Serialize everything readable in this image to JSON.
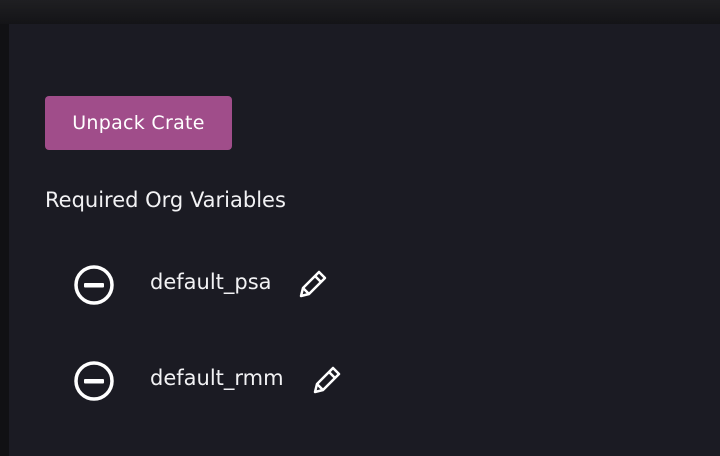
{
  "actions": {
    "unpack_label": "Unpack Crate"
  },
  "org_variables": {
    "title": "Required Org Variables",
    "items": [
      {
        "name": "default_psa",
        "remove_icon": "minus-circle-icon",
        "edit_icon": "pencil-icon"
      },
      {
        "name": "default_rmm",
        "remove_icon": "minus-circle-icon",
        "edit_icon": "pencil-icon"
      }
    ]
  },
  "colors": {
    "background": "#1b1b23",
    "accent": "#a04d8a",
    "text": "#f2f2f4"
  }
}
